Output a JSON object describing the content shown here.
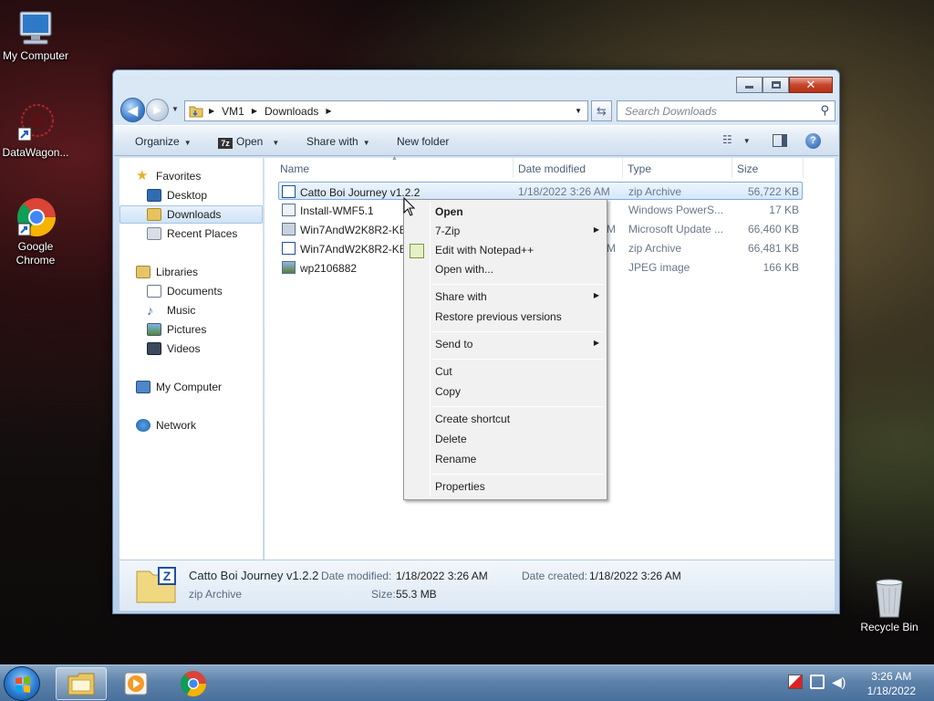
{
  "desktop": {
    "icons": [
      {
        "label": "My Computer"
      },
      {
        "label": "DataWagon..."
      },
      {
        "label": "Google Chrome"
      },
      {
        "label": "Recycle Bin"
      }
    ]
  },
  "window": {
    "breadcrumb": [
      "VM1",
      "Downloads"
    ],
    "search_placeholder": "Search Downloads",
    "toolbar": {
      "organize": "Organize",
      "open": "Open",
      "share_with": "Share with",
      "new_folder": "New folder"
    },
    "nav": {
      "favorites": "Favorites",
      "desktop": "Desktop",
      "downloads": "Downloads",
      "recent_places": "Recent Places",
      "libraries": "Libraries",
      "documents": "Documents",
      "music": "Music",
      "pictures": "Pictures",
      "videos": "Videos",
      "my_computer": "My Computer",
      "network": "Network"
    },
    "columns": {
      "name": "Name",
      "date_modified": "Date modified",
      "type": "Type",
      "size": "Size"
    },
    "files": [
      {
        "name": "Catto Boi Journey v1.2.2",
        "date": "1/18/2022 3:26 AM",
        "type": "zip Archive",
        "size": "56,722 KB"
      },
      {
        "name": "Install-WMF5.1",
        "date": "",
        "type": "Windows PowerS...",
        "size": "17 KB"
      },
      {
        "name": "Win7AndW2K8R2-KB3",
        "date": "M",
        "type": "Microsoft Update ...",
        "size": "66,460 KB"
      },
      {
        "name": "Win7AndW2K8R2-KB3",
        "date": "M",
        "type": "zip Archive",
        "size": "66,481 KB"
      },
      {
        "name": "wp2106882",
        "date": "",
        "type": "JPEG image",
        "size": "166 KB"
      }
    ],
    "details": {
      "name": "Catto Boi Journey v1.2.2",
      "type": "zip Archive",
      "date_modified_label": "Date modified:",
      "date_modified": "1/18/2022 3:26 AM",
      "date_created_label": "Date created:",
      "date_created": "1/18/2022 3:26 AM",
      "size_label": "Size:",
      "size": "55.3 MB"
    }
  },
  "context_menu": {
    "open": "Open",
    "seven_zip": "7-Zip",
    "edit_notepad": "Edit with Notepad++",
    "open_with": "Open with...",
    "share_with": "Share with",
    "restore": "Restore previous versions",
    "send_to": "Send to",
    "cut": "Cut",
    "copy": "Copy",
    "create_shortcut": "Create shortcut",
    "delete": "Delete",
    "rename": "Rename",
    "properties": "Properties"
  },
  "taskbar": {
    "time": "3:26 AM",
    "date": "1/18/2022"
  },
  "colors": {
    "accent": "#3f7dc8",
    "selection": "#d5e7fa",
    "taskbar": "#5d82aa"
  }
}
